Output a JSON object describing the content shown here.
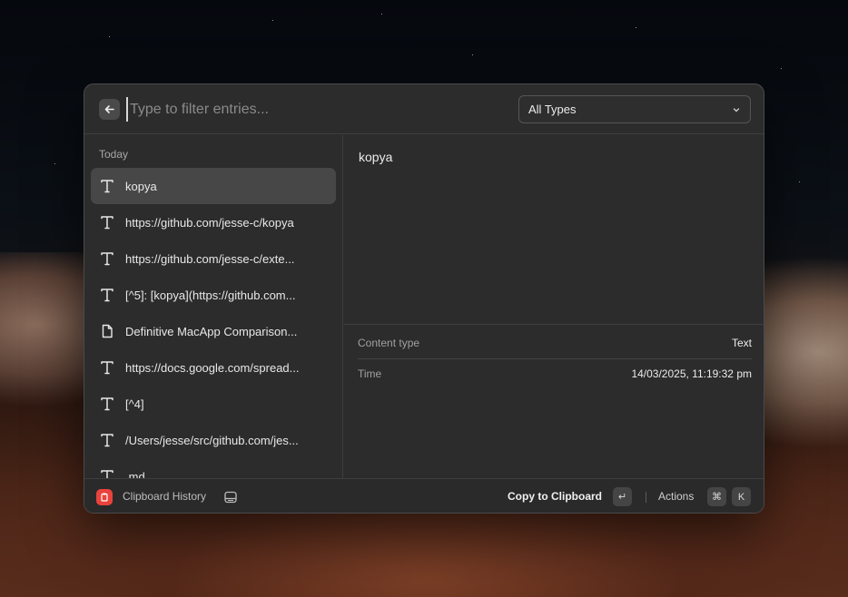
{
  "header": {
    "search_placeholder": "Type to filter entries...",
    "type_filter": "All Types"
  },
  "list": {
    "section_title": "Today",
    "items": [
      {
        "icon": "text-icon",
        "label": "kopya"
      },
      {
        "icon": "text-icon",
        "label": "https://github.com/jesse-c/kopya"
      },
      {
        "icon": "text-icon",
        "label": "https://github.com/jesse-c/exte..."
      },
      {
        "icon": "text-icon",
        "label": "[^5]: [kopya](https://github.com..."
      },
      {
        "icon": "file-icon",
        "label": "Definitive MacApp Comparison..."
      },
      {
        "icon": "text-icon",
        "label": "https://docs.google.com/spread..."
      },
      {
        "icon": "text-icon",
        "label": "[^4]"
      },
      {
        "icon": "text-icon",
        "label": "/Users/jesse/src/github.com/jes..."
      },
      {
        "icon": "text-icon",
        "label": ".md"
      }
    ]
  },
  "detail": {
    "preview": "kopya",
    "content_type_label": "Content type",
    "content_type_value": "Text",
    "time_label": "Time",
    "time_value": "14/03/2025, 11:19:32 pm"
  },
  "footer": {
    "app_name": "Clipboard History",
    "primary_action": "Copy to Clipboard",
    "primary_key": "↵",
    "actions_label": "Actions",
    "actions_key_1": "⌘",
    "actions_key_2": "K"
  },
  "colors": {
    "window_bg": "#2c2c2c",
    "selected_bg": "#474747",
    "app_icon_red": "#e8433c"
  }
}
